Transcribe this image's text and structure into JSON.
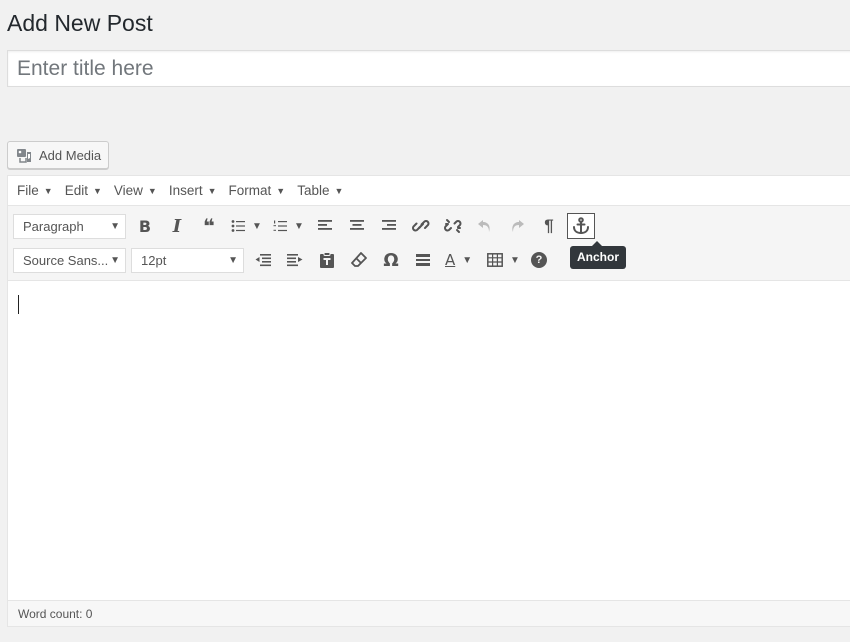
{
  "page": {
    "title": "Add New Post"
  },
  "title_field": {
    "placeholder": "Enter title here",
    "value": ""
  },
  "media": {
    "add_media_label": "Add Media"
  },
  "menubar": {
    "items": [
      {
        "label": "File"
      },
      {
        "label": "Edit"
      },
      {
        "label": "View"
      },
      {
        "label": "Insert"
      },
      {
        "label": "Format"
      },
      {
        "label": "Table"
      }
    ]
  },
  "toolbar": {
    "format_select": "Paragraph",
    "font_family_select": "Source Sans...",
    "font_size_select": "12pt",
    "row1_icons": [
      "bold-icon",
      "italic-icon",
      "blockquote-icon",
      "bullet-list-icon",
      "numbered-list-icon",
      "align-left-icon",
      "align-center-icon",
      "align-right-icon",
      "link-icon",
      "unlink-icon",
      "undo-icon",
      "redo-icon",
      "paragraph-icon",
      "anchor-icon"
    ],
    "row2_icons": [
      "outdent-icon",
      "indent-icon",
      "paste-text-icon",
      "clear-format-icon",
      "special-char-icon",
      "horizontal-rule-icon",
      "text-color-icon",
      "table-icon",
      "help-icon"
    ],
    "bold_glyph": "B",
    "italic_glyph": "I",
    "blockquote_glyph": "❝",
    "paragraph_glyph": "¶",
    "omega_glyph": "Ω",
    "text_color_glyph": "A",
    "help_glyph": "?"
  },
  "tooltip": {
    "text": "Anchor"
  },
  "statusbar": {
    "word_count": "Word count: 0"
  },
  "colors": {
    "background": "#f1f1f1",
    "tooltip_bg": "#32373c",
    "icon": "#555555"
  }
}
